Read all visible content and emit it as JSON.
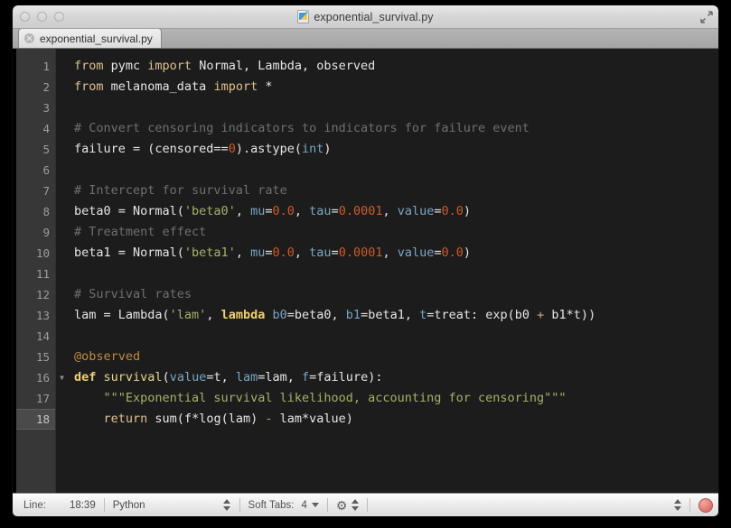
{
  "window": {
    "title": "exponential_survival.py",
    "doc_icon": "document-pencil-icon",
    "fullscreen_icon": "fullscreen-expand-icon",
    "traffic_lights": [
      "close-button",
      "minimize-button",
      "zoom-button"
    ]
  },
  "tabs": [
    {
      "label": "exponential_survival.py",
      "close_icon": "close-icon",
      "active": true
    }
  ],
  "editor": {
    "language": "Python",
    "active_line": 18,
    "fold_marker_line": 16,
    "fold_icon": "chevron-down-icon",
    "lines": [
      {
        "n": "1",
        "tokens": [
          {
            "t": "from",
            "c": "kw"
          },
          {
            "t": " pymc ",
            "c": "pl"
          },
          {
            "t": "import",
            "c": "kw"
          },
          {
            "t": " Normal, Lambda, observed",
            "c": "pl"
          }
        ]
      },
      {
        "n": "2",
        "tokens": [
          {
            "t": "from",
            "c": "kw"
          },
          {
            "t": " melanoma_data ",
            "c": "pl"
          },
          {
            "t": "import",
            "c": "kw"
          },
          {
            "t": " *",
            "c": "pl"
          }
        ]
      },
      {
        "n": "3",
        "tokens": []
      },
      {
        "n": "4",
        "tokens": [
          {
            "t": "# Convert censoring indicators to indicators for failure event",
            "c": "com"
          }
        ]
      },
      {
        "n": "5",
        "tokens": [
          {
            "t": "failure = (censored==",
            "c": "pl"
          },
          {
            "t": "0",
            "c": "num"
          },
          {
            "t": ").astype(",
            "c": "pl"
          },
          {
            "t": "int",
            "c": "bi"
          },
          {
            "t": ")",
            "c": "pl"
          }
        ]
      },
      {
        "n": "6",
        "tokens": []
      },
      {
        "n": "7",
        "tokens": [
          {
            "t": "# Intercept for survival rate",
            "c": "com"
          }
        ]
      },
      {
        "n": "8",
        "tokens": [
          {
            "t": "beta0 = Normal(",
            "c": "pl"
          },
          {
            "t": "'beta0'",
            "c": "str"
          },
          {
            "t": ", ",
            "c": "pl"
          },
          {
            "t": "mu",
            "c": "par"
          },
          {
            "t": "=",
            "c": "pl"
          },
          {
            "t": "0.0",
            "c": "num"
          },
          {
            "t": ", ",
            "c": "pl"
          },
          {
            "t": "tau",
            "c": "par"
          },
          {
            "t": "=",
            "c": "pl"
          },
          {
            "t": "0.0001",
            "c": "num"
          },
          {
            "t": ", ",
            "c": "pl"
          },
          {
            "t": "value",
            "c": "par"
          },
          {
            "t": "=",
            "c": "pl"
          },
          {
            "t": "0.0",
            "c": "num"
          },
          {
            "t": ")",
            "c": "pl"
          }
        ]
      },
      {
        "n": "9",
        "tokens": [
          {
            "t": "# Treatment effect",
            "c": "com"
          }
        ]
      },
      {
        "n": "10",
        "tokens": [
          {
            "t": "beta1 = Normal(",
            "c": "pl"
          },
          {
            "t": "'beta1'",
            "c": "str"
          },
          {
            "t": ", ",
            "c": "pl"
          },
          {
            "t": "mu",
            "c": "par"
          },
          {
            "t": "=",
            "c": "pl"
          },
          {
            "t": "0.0",
            "c": "num"
          },
          {
            "t": ", ",
            "c": "pl"
          },
          {
            "t": "tau",
            "c": "par"
          },
          {
            "t": "=",
            "c": "pl"
          },
          {
            "t": "0.0001",
            "c": "num"
          },
          {
            "t": ", ",
            "c": "pl"
          },
          {
            "t": "value",
            "c": "par"
          },
          {
            "t": "=",
            "c": "pl"
          },
          {
            "t": "0.0",
            "c": "num"
          },
          {
            "t": ")",
            "c": "pl"
          }
        ]
      },
      {
        "n": "11",
        "tokens": []
      },
      {
        "n": "12",
        "tokens": [
          {
            "t": "# Survival rates",
            "c": "com"
          }
        ]
      },
      {
        "n": "13",
        "tokens": [
          {
            "t": "lam = Lambda(",
            "c": "pl"
          },
          {
            "t": "'lam'",
            "c": "str"
          },
          {
            "t": ", ",
            "c": "pl"
          },
          {
            "t": "lambda",
            "c": "kw2"
          },
          {
            "t": " ",
            "c": "pl"
          },
          {
            "t": "b0",
            "c": "par"
          },
          {
            "t": "=beta0, ",
            "c": "pl"
          },
          {
            "t": "b1",
            "c": "par"
          },
          {
            "t": "=beta1, ",
            "c": "pl"
          },
          {
            "t": "t",
            "c": "par"
          },
          {
            "t": "=treat: exp(b0 ",
            "c": "pl"
          },
          {
            "t": "+",
            "c": "op"
          },
          {
            "t": " b1*t))",
            "c": "pl"
          }
        ]
      },
      {
        "n": "14",
        "tokens": []
      },
      {
        "n": "15",
        "tokens": [
          {
            "t": "@observed",
            "c": "dec"
          }
        ]
      },
      {
        "n": "16",
        "tokens": [
          {
            "t": "def",
            "c": "kw2"
          },
          {
            "t": " ",
            "c": "pl"
          },
          {
            "t": "survival",
            "c": "fn"
          },
          {
            "t": "(",
            "c": "pl"
          },
          {
            "t": "value",
            "c": "par"
          },
          {
            "t": "=t, ",
            "c": "pl"
          },
          {
            "t": "lam",
            "c": "par"
          },
          {
            "t": "=lam, ",
            "c": "pl"
          },
          {
            "t": "f",
            "c": "par"
          },
          {
            "t": "=failure):",
            "c": "pl"
          }
        ]
      },
      {
        "n": "17",
        "tokens": [
          {
            "t": "    \"\"\"Exponential survival likelihood, accounting for censoring\"\"\"",
            "c": "str"
          }
        ]
      },
      {
        "n": "18",
        "tokens": [
          {
            "t": "    ",
            "c": "pl"
          },
          {
            "t": "return",
            "c": "kw"
          },
          {
            "t": " sum(f*log(lam) ",
            "c": "pl"
          },
          {
            "t": "-",
            "c": "op"
          },
          {
            "t": " lam*value)",
            "c": "pl"
          }
        ]
      }
    ]
  },
  "statusbar": {
    "line_label": "Line:",
    "line_value": "18:39",
    "language": "Python",
    "language_stepper_icon": "stepper-icon",
    "soft_tabs_label": "Soft Tabs:",
    "soft_tabs_value": "4",
    "soft_tabs_caret_icon": "caret-down-icon",
    "gear_icon": "gear-icon",
    "gear_stepper_icon": "stepper-icon",
    "right_stepper_icon": "stepper-icon",
    "record_button_icon": "record-button-icon"
  },
  "colors": {
    "editor_bg": "#1c1c1c",
    "gutter_bg": "#373737",
    "active_line_gutter": "#4a4a4a",
    "keyword": "#e0c090",
    "comment": "#6f6f6f",
    "string": "#a5b16a",
    "number": "#cf5a28",
    "param": "#7aa6c2",
    "function": "#e8d48a",
    "decorator": "#c08a3e",
    "record_red": "#d96f66"
  }
}
